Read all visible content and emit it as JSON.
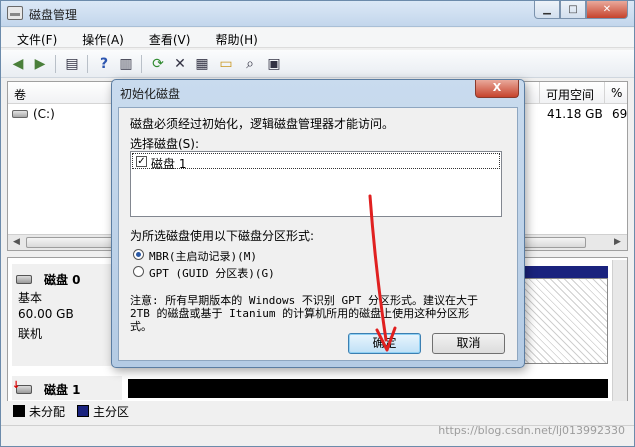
{
  "window": {
    "title": "磁盘管理"
  },
  "menu": [
    "文件(F)",
    "操作(A)",
    "查看(V)",
    "帮助(H)"
  ],
  "toolbar_icons": [
    "back-arrow-icon",
    "forward-arrow-icon",
    "console-tree-icon",
    "help-icon",
    "help-book-icon",
    "refresh-icon",
    "delete-icon",
    "properties-icon",
    "open-folder-icon",
    "search-icon",
    "view-icon"
  ],
  "list": {
    "columns": {
      "volume": "卷",
      "free": "可用空间",
      "percent": "%"
    },
    "rows": [
      {
        "volume": "(C:)",
        "free": "41.18 GB",
        "percent": "69"
      }
    ]
  },
  "disks": [
    {
      "name": "磁盘 0",
      "type": "基本",
      "size": "60.00 GB",
      "status": "联机"
    },
    {
      "name": "磁盘 1"
    }
  ],
  "legend": [
    {
      "label": "未分配",
      "color": "#000000"
    },
    {
      "label": "主分区",
      "color": "#1a237e"
    }
  ],
  "dialog": {
    "title": "初始化磁盘",
    "close": "X",
    "intro": "磁盘必须经过初始化，逻辑磁盘管理器才能访问。",
    "select_label": "选择磁盘(S):",
    "disk_item": "磁盘 1",
    "style_label": "为所选磁盘使用以下磁盘分区形式:",
    "options": [
      "MBR(主启动记录)(M)",
      "GPT (GUID 分区表)(G)"
    ],
    "note_lines": [
      "注意: 所有早期版本的 Windows 不识别 GPT 分区形式。建议在大于",
      "2TB 的磁盘或基于 Itanium 的计算机所用的磁盘上使用这种分区形",
      "式。"
    ],
    "ok": "确定",
    "cancel": "取消"
  },
  "watermark": "https://blog.csdn.net/lj013992330",
  "colors": {
    "accent": "#3c7fb1",
    "annotation_arrow": "#e02020",
    "primary_partition": "#1a237e"
  }
}
